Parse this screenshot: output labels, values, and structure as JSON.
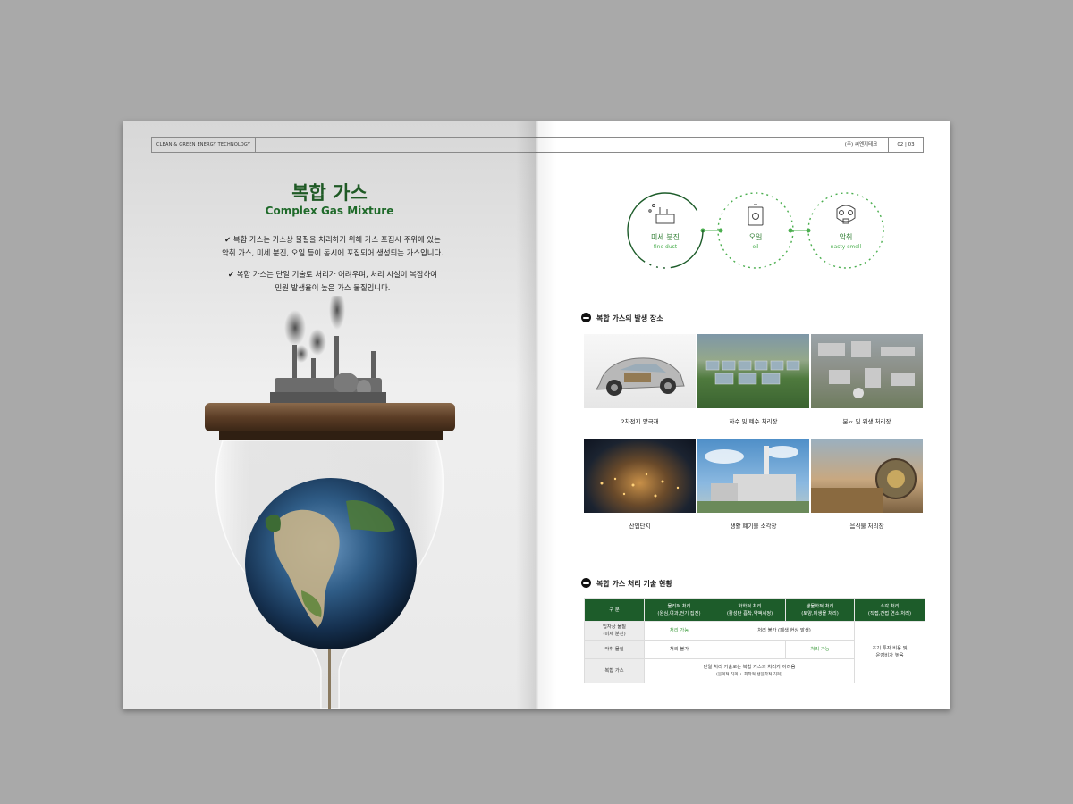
{
  "header": {
    "left_label": "CLEAN & GREEN ENERGY TECHNOLOGY",
    "company": "(주) 씨엔지테크",
    "page_numbers": "02 | 03"
  },
  "left_page": {
    "title_ko": "복합 가스",
    "title_en": "Complex Gas Mixture",
    "bullets": [
      {
        "line1": "✔ 복합 가스는 가스상 물질을 처리하기 위해 가스 포집시 주위에 있는",
        "line2": "악취 가스, 미세 분진, 오일 등이 동시에 포집되어 생성되는 가스입니다."
      },
      {
        "line1": "✔ 복합 가스는 단일 기술로 처리가 어려우며, 처리 시설이 복잡하여",
        "line2": "민원 발생율이 높은 가스 물질입니다."
      }
    ]
  },
  "circles": [
    {
      "ko": "미세 분진",
      "en": "fine dust",
      "icon": "factory-smoke-icon"
    },
    {
      "ko": "오일",
      "en": "oil",
      "icon": "oil-can-icon"
    },
    {
      "ko": "악취",
      "en": "nasty smell",
      "icon": "gas-mask-icon"
    }
  ],
  "section1": {
    "title": "복합 가스의 발생 장소",
    "places": [
      "2차전지 양극재",
      "하수 및 폐수 처리장",
      "분뇨 및 위생 처리장",
      "산업단지",
      "생활 폐기물 소각장",
      "음식물 처리장"
    ]
  },
  "section2": {
    "title": "복합 가스 처리 기술 현황",
    "headers": [
      {
        "l1": "구    분",
        "l2": ""
      },
      {
        "l1": "물리적 처리",
        "l2": "(원심,여과,전기 집진)"
      },
      {
        "l1": "화학적 처리",
        "l2": "(활성탄 흡착,약액세정)"
      },
      {
        "l1": "생물학적 처리",
        "l2": "(토양,미생물 처리)"
      },
      {
        "l1": "소각 처리",
        "l2": "(직접,간접 연소 처리)"
      }
    ],
    "rows": {
      "r1_label_l1": "입자상 물질",
      "r1_label_l2": "(미세 분진)",
      "r1_physical": "처리 가능",
      "r1_chem_bio": "처리 불가 (폐색 현상 발생)",
      "r2_label": "악취 물질",
      "r2_physical": "처리 불가",
      "r2_bio": "처리 가능",
      "r3_label": "복합 가스",
      "r3_l1": "단일 처리 기술로는 복합 가스의 처리가 어려움",
      "r3_l2": "(물리적 처리 + 화학적·생물학적 처리)",
      "incin_l1": "초기 투자 비용 및",
      "incin_l2": "운영비가 높음"
    }
  },
  "colors": {
    "brand_green": "#1d5c2a",
    "light_green": "#3a9a3a",
    "circle_green": "#4caf50"
  }
}
